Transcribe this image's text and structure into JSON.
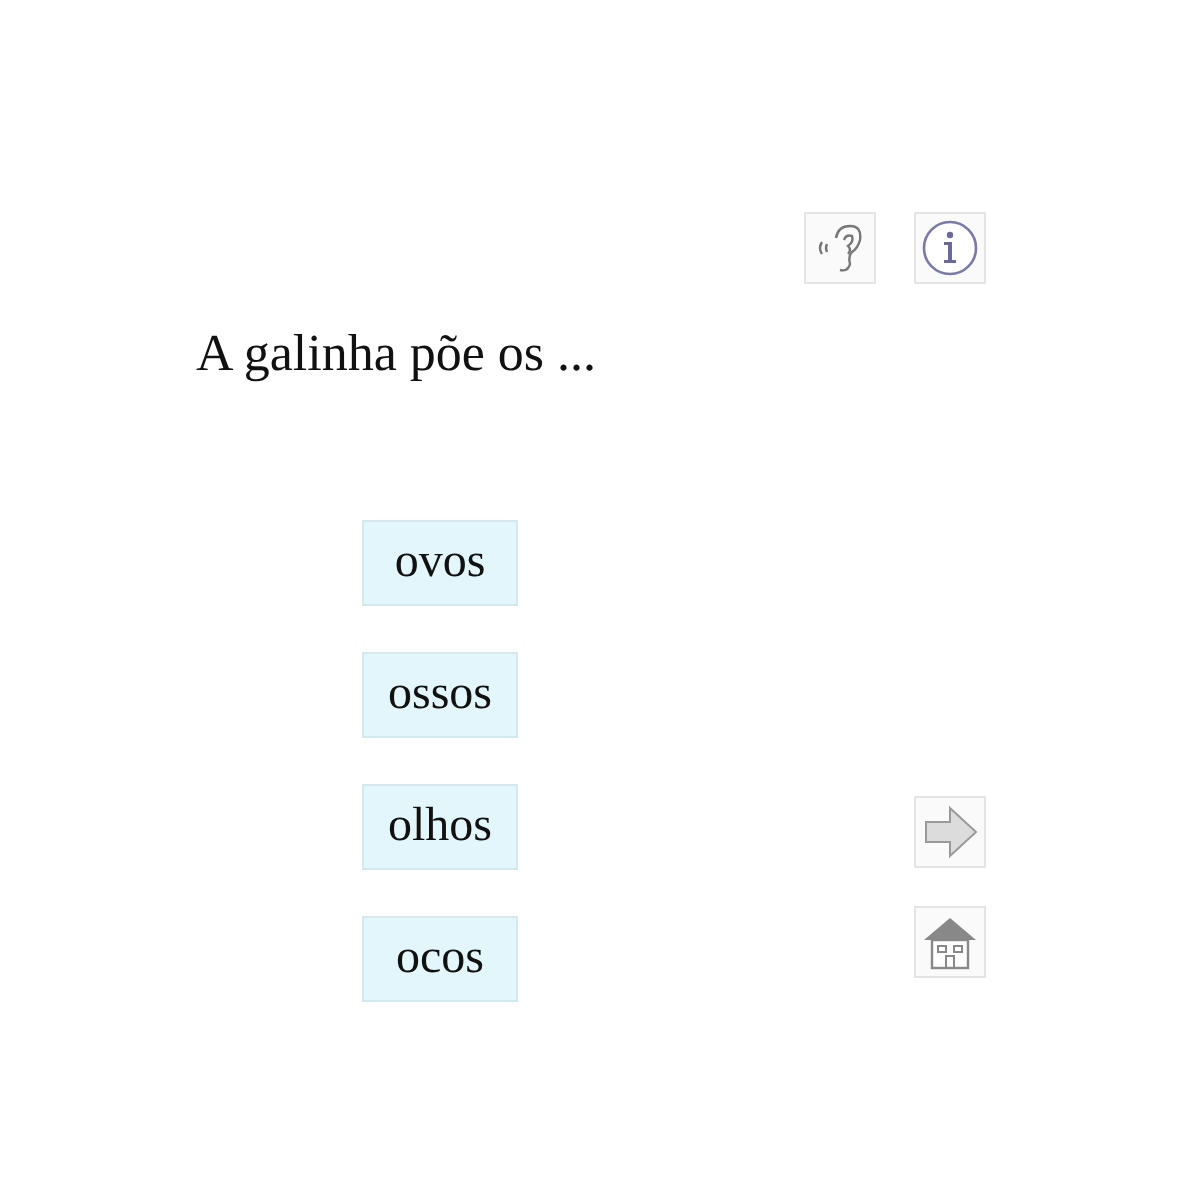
{
  "question": "A galinha põe os ...",
  "options": [
    {
      "label": "ovos"
    },
    {
      "label": "ossos"
    },
    {
      "label": "olhos"
    },
    {
      "label": "ocos"
    }
  ]
}
